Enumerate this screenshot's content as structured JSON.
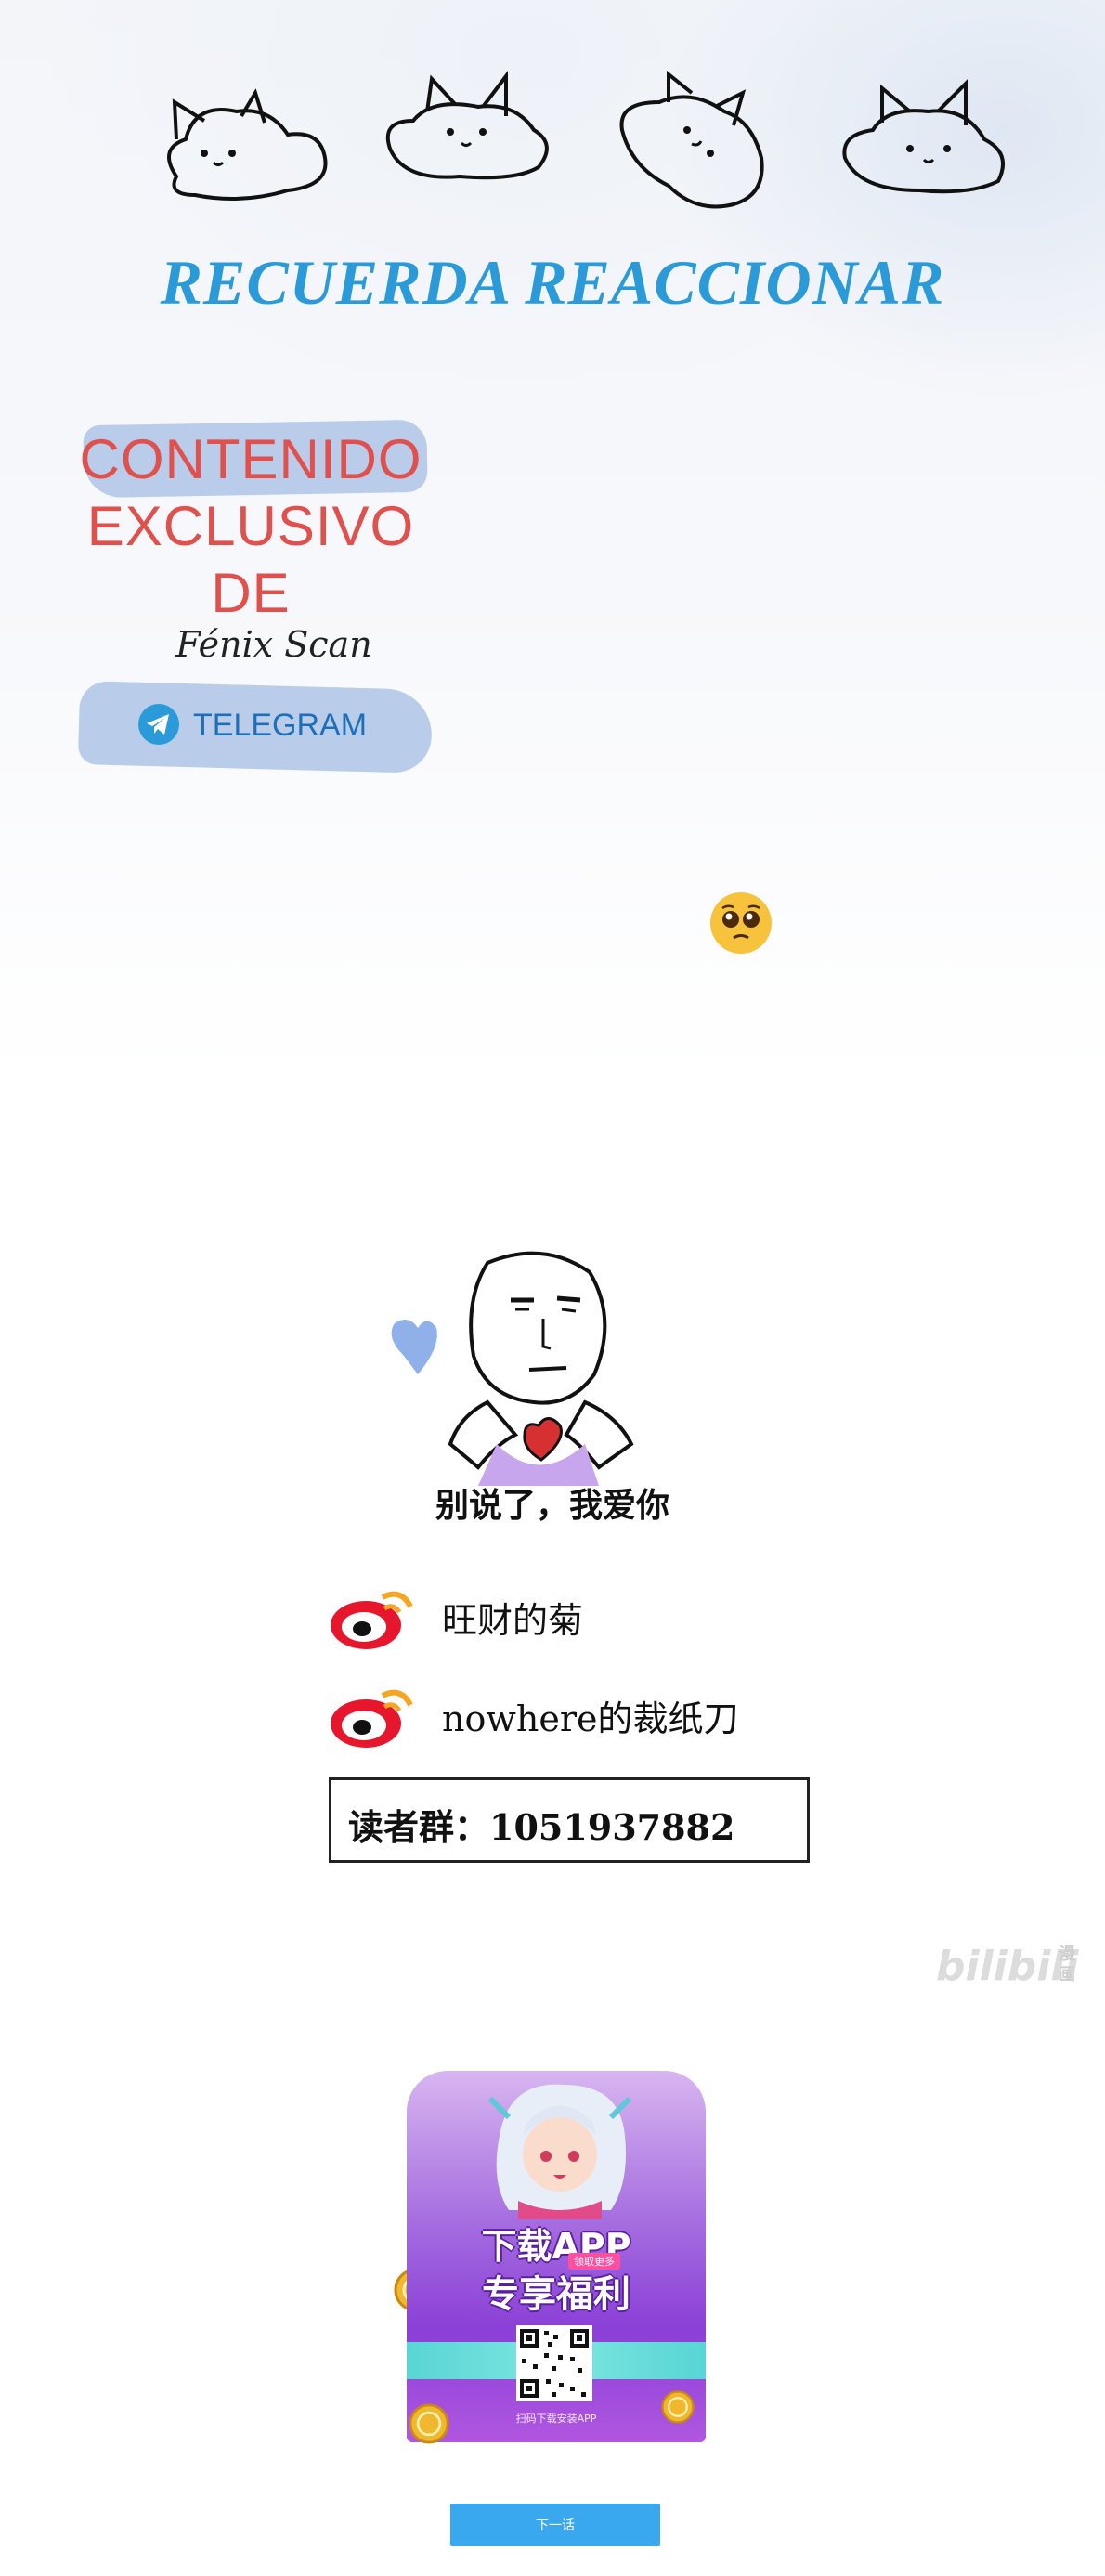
{
  "header": {
    "headline": "RECUERDA REACCIONAR",
    "decoration_icons": [
      "cat-cloud-icon",
      "cat-cloud-icon",
      "cat-cloud-icon",
      "cat-cloud-icon"
    ]
  },
  "promo": {
    "line1": "CONTENIDO",
    "line2": "EXCLUSIVO",
    "line3": "DE",
    "signature": "Fénix Scan",
    "telegram_label": "TELEGRAM",
    "text_color": "#e0504d",
    "blob_color": "#b9cdea",
    "telegram_color": "#1f6fb8"
  },
  "meme": {
    "caption": "别说了，我爱你"
  },
  "credits": {
    "items": [
      {
        "icon": "weibo-icon",
        "name": "旺财的菊"
      },
      {
        "icon": "weibo-icon",
        "name": "nowhere的裁纸刀"
      }
    ],
    "reader_group": "读者群：1051937882"
  },
  "watermark": {
    "main": "bilibili",
    "sub": "漫画"
  },
  "app_promo": {
    "title_line1": "下载APP",
    "tag": "领取更多",
    "title_line2": "专享福利",
    "hint": "扫码下载安装APP"
  },
  "navigation": {
    "next_button_label": "下一话",
    "accent": "#3aa8ef"
  }
}
